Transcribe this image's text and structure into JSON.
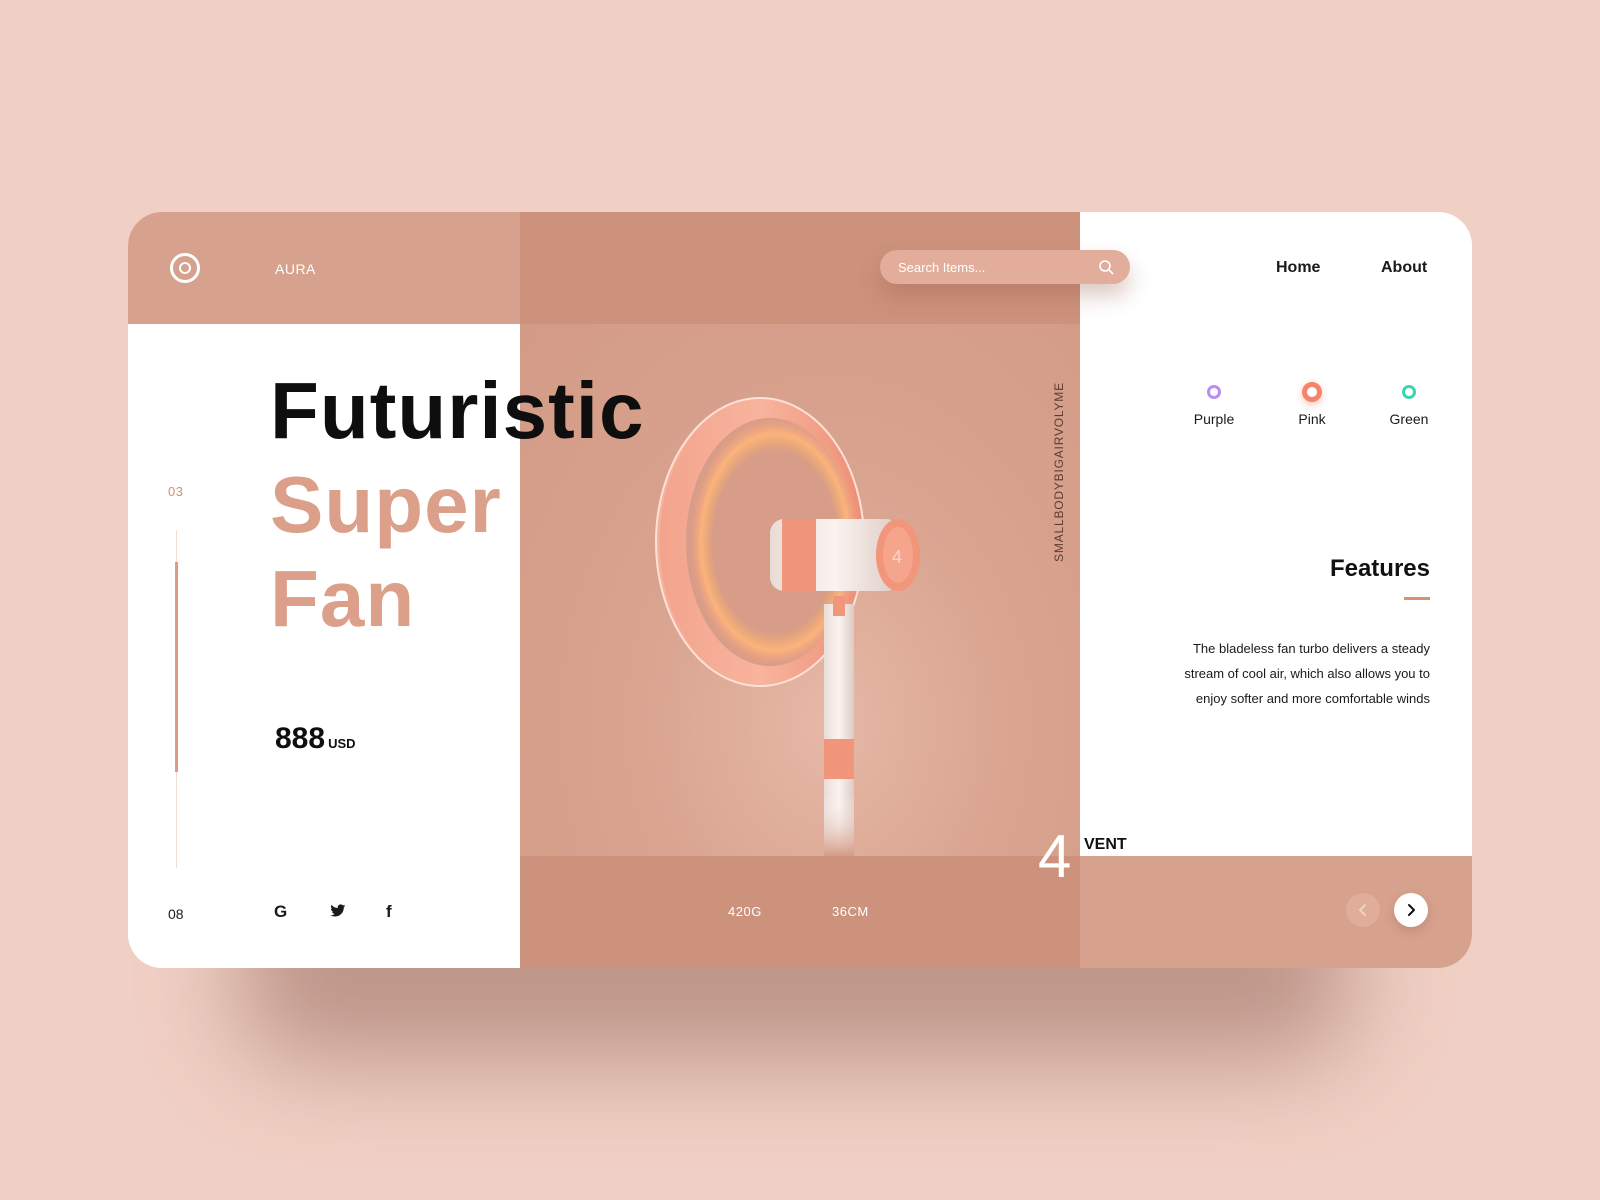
{
  "header": {
    "brand": "AURA",
    "search": {
      "placeholder": "Search Items..."
    },
    "nav": {
      "home": "Home",
      "about": "About"
    }
  },
  "hero": {
    "title_line1": "Futuristic",
    "title_line2": "Super",
    "title_line3": "Fan",
    "slide_current": "03",
    "slide_total": "08",
    "slide_progress_fraction": 0.375,
    "price": {
      "amount": "888",
      "currency": "USD"
    },
    "social": {
      "google": "G",
      "twitter": "twitter-icon",
      "facebook": "f"
    }
  },
  "product": {
    "vertical_label": "SMALLBODYBIGAIRVOLYME",
    "specs": {
      "weight": "420G",
      "size": "36CM"
    },
    "vent": {
      "number": "4",
      "label": "VENT"
    }
  },
  "colors": {
    "options": [
      {
        "name": "Purple",
        "hex": "#b98cf2",
        "selected": false
      },
      {
        "name": "Pink",
        "hex": "#f5856a",
        "selected": true
      },
      {
        "name": "Green",
        "hex": "#3bd6b0",
        "selected": false
      }
    ]
  },
  "features": {
    "title": "Features",
    "text": "The bladeless fan turbo delivers a steady stream of cool air, which also allows you to enjoy softer and more comfortable winds"
  },
  "theme": {
    "background": "#f0cfc4",
    "panel_light": "#d6a18d",
    "panel_dark": "#cc927c",
    "accent": "#dc9f8a"
  }
}
